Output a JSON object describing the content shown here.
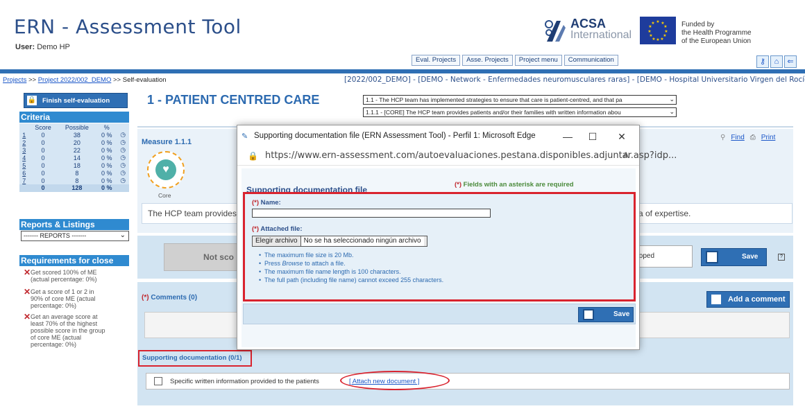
{
  "header": {
    "title": "ERN - Assessment Tool",
    "user_label": "User:",
    "user_name": "Demo HP",
    "acsa_name": "ACSA",
    "acsa_sub": "International",
    "eu_text_1": "Funded by",
    "eu_text_2": "the Health Programme",
    "eu_text_3": "of the European Union",
    "nav": [
      "Eval. Projects",
      "Asse. Projects",
      "Project menu",
      "Communication"
    ]
  },
  "breadcrumb": {
    "projects": "Projects",
    "sep": ">>",
    "project": "Project 2022/002_DEMO",
    "current": "Self-evaluation",
    "info": "[2022/002_DEMO] - [DEMO - Network - Enfermedades neuromusculares raras] - [DEMO - Hospital Universitario Virgen del Rocío]"
  },
  "sidebar": {
    "finish_label": "Finish self-evaluation",
    "criteria_title": "Criteria",
    "columns": [
      "Score",
      "Possible",
      "%"
    ],
    "rows": [
      {
        "n": "1",
        "score": "0",
        "possible": "38",
        "pct": "0 %"
      },
      {
        "n": "2",
        "score": "0",
        "possible": "20",
        "pct": "0 %"
      },
      {
        "n": "3",
        "score": "0",
        "possible": "22",
        "pct": "0 %"
      },
      {
        "n": "4",
        "score": "0",
        "possible": "14",
        "pct": "0 %"
      },
      {
        "n": "5",
        "score": "0",
        "possible": "18",
        "pct": "0 %"
      },
      {
        "n": "6",
        "score": "0",
        "possible": "8",
        "pct": "0 %"
      },
      {
        "n": "7",
        "score": "0",
        "possible": "8",
        "pct": "0 %"
      }
    ],
    "total": {
      "score": "0",
      "possible": "128",
      "pct": "0 %"
    },
    "reports_title": "Reports & Listings",
    "reports_select": "------- REPORTS -------",
    "requirements_title": "Requirements for close",
    "requirements": [
      "Get scored 100% of ME (actual percentage: 0%)",
      "Get a score of 1 or 2 in 90% of core ME (actual percentage: 0%)",
      "Get an average score at least 70% of the highest possible score in the group of core ME (actual percentage: 0%)"
    ]
  },
  "main": {
    "criterion_title": "1 - PATIENT CENTRED CARE",
    "standard_select": "1.1 - The HCP team has implemented strategies to ensure that care is patient-centred, and that pa",
    "measure_select": "1.1.1 - [CORE] The HCP team provides patients and/or their families with written information abou",
    "measure_label": "Measure 1.1.1",
    "core_label": "Core",
    "measure_text_start": "The HCP team provides",
    "measure_text_end": "a of expertise.",
    "find_label": "Find",
    "print_label": "Print",
    "not_scored_label": "Not sco",
    "dev_select": "eloped",
    "save_label": "Save",
    "help": "?",
    "comments_label": "Comments (0)",
    "comments_req": "(*)",
    "add_comment_label": "Add a comment",
    "docs_label": "Supporting documentation (0/1)",
    "doc_item": "Specific written information provided to the patients",
    "attach_link": "[ Attach new document ]"
  },
  "popup": {
    "window_title": "Supporting documentation file (ERN Assessment Tool) - Perfil 1: Microsoft Edge",
    "url": "https://www.ern-assessment.com/autoevaluaciones.pestana.disponibles.adjuntar.asp?idp...",
    "heading": "Supporting documentation file",
    "required_note_mark": "(*)",
    "required_note": "Fields with an asterisk are required",
    "name_req": "(*)",
    "name_label": "Name:",
    "file_req": "(*)",
    "file_label": "Attached file:",
    "file_button": "Elegir archivo",
    "file_status": "No se ha seleccionado ningún archivo",
    "hints": [
      "The maximum file size is 20 Mb.",
      "to attach a file.",
      "The maximum file name length is 100 characters.",
      "The full path (including file name) cannot exceed 255 characters."
    ],
    "hint_press": "Press",
    "hint_browse": "Browse",
    "save_label": "Save"
  },
  "colors": {
    "accent_blue": "#2f6fb4",
    "highlight_red": "#d9232e",
    "title_blue": "#2c6ab0"
  }
}
